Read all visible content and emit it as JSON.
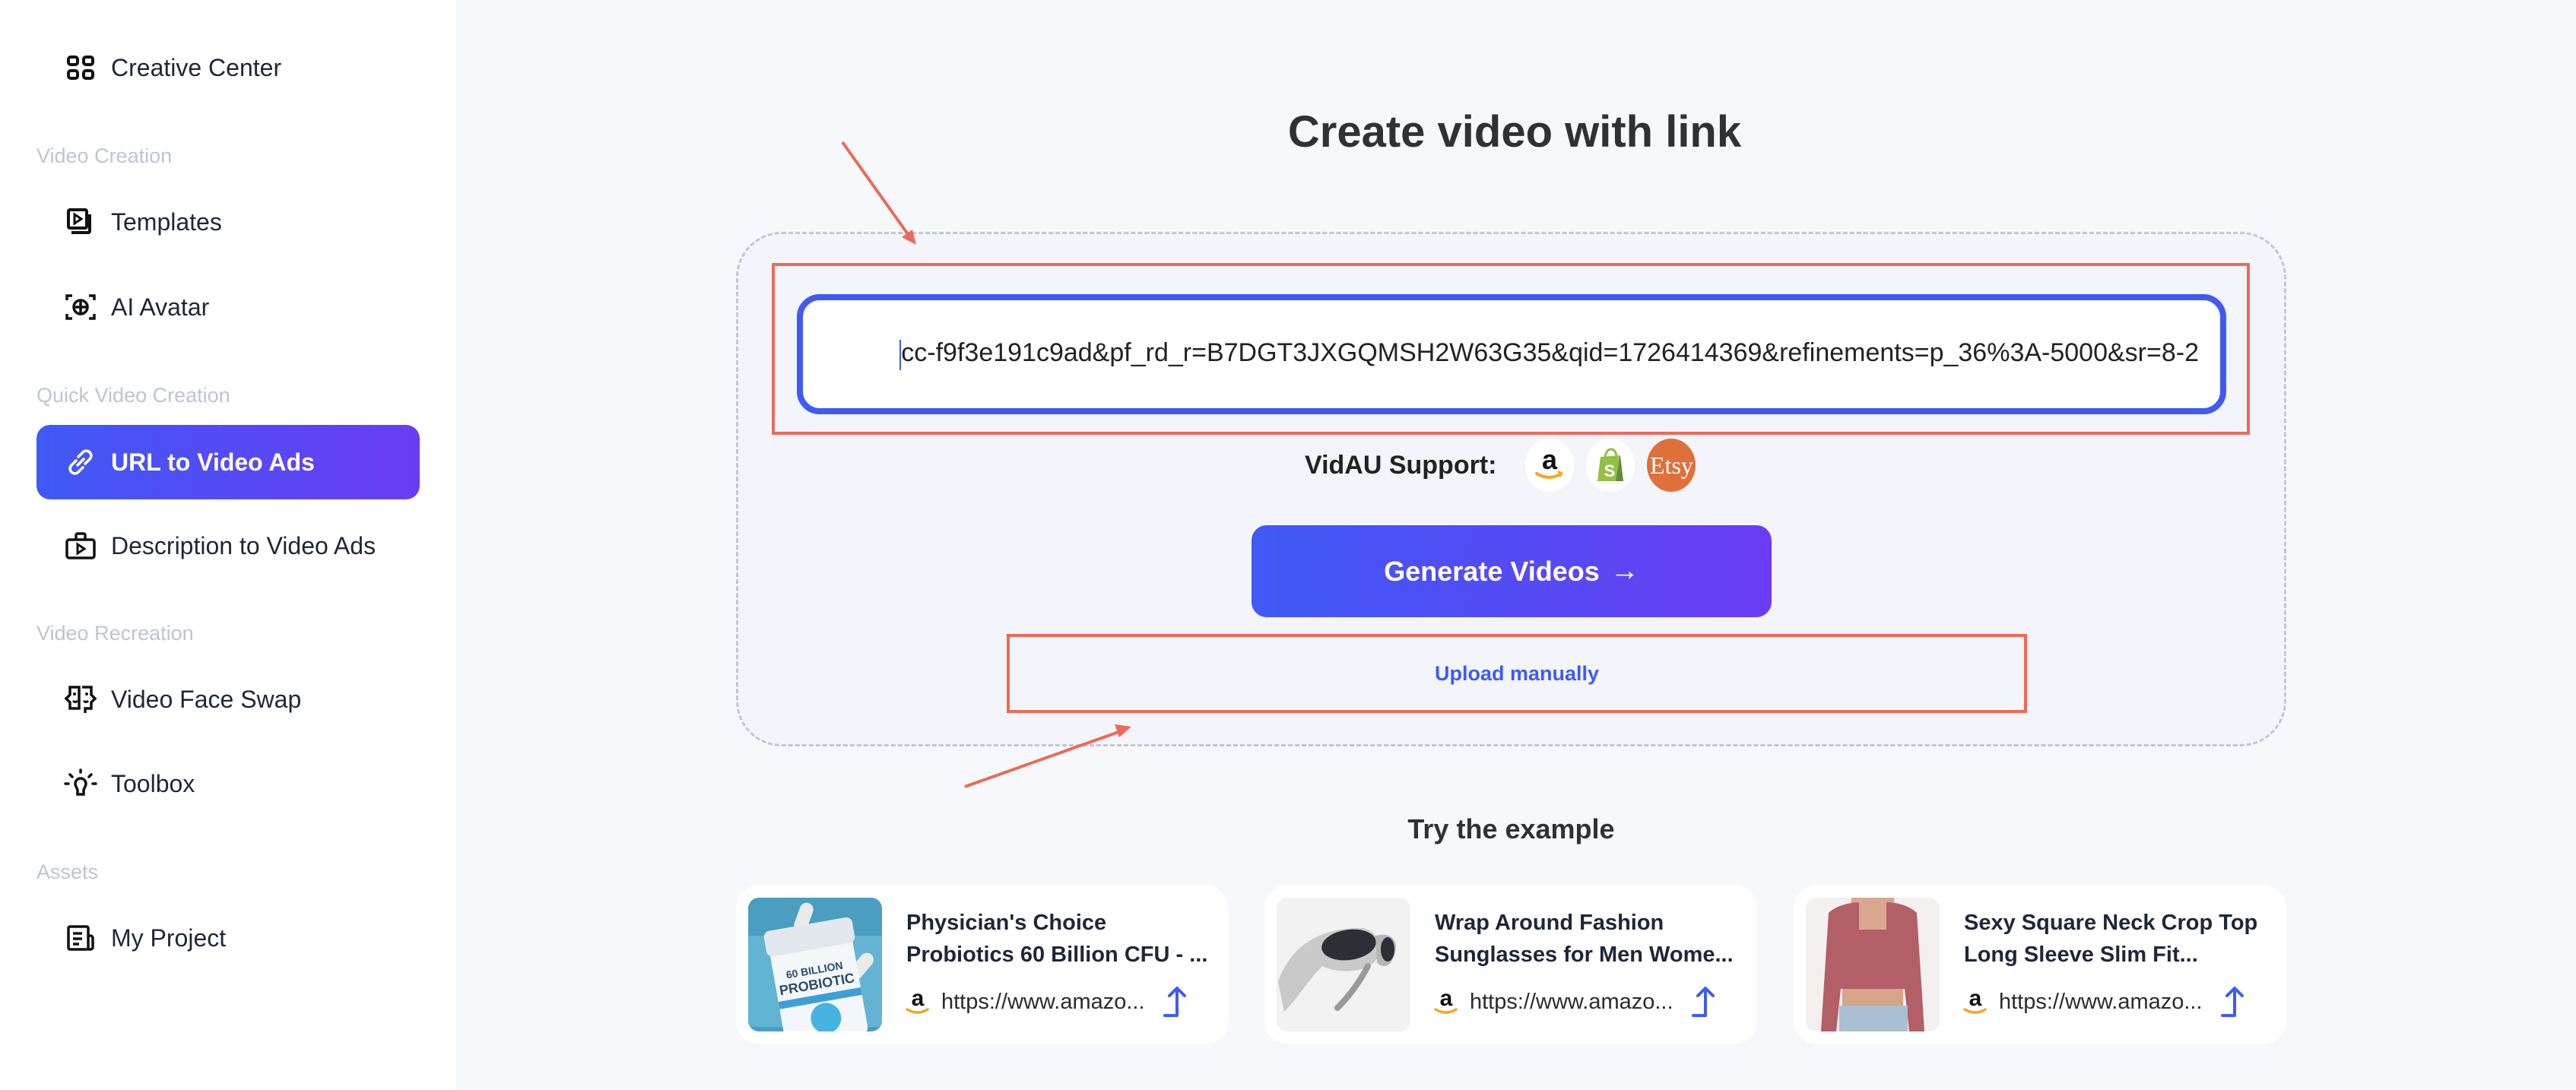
{
  "sidebar": {
    "top_item": {
      "label": "Creative Center",
      "icon": "grid-icon"
    },
    "sections": [
      {
        "label": "Video Creation",
        "items": [
          {
            "label": "Templates",
            "icon": "video-templates-icon"
          },
          {
            "label": "AI Avatar",
            "icon": "ai-avatar-icon"
          }
        ]
      },
      {
        "label": "Quick Video Creation",
        "items": [
          {
            "label": "URL to Video Ads",
            "icon": "link-icon",
            "active": true
          },
          {
            "label": "Description to Video Ads",
            "icon": "video-bag-icon"
          }
        ]
      },
      {
        "label": "Video Recreation",
        "items": [
          {
            "label": "Video Face Swap",
            "icon": "face-swap-icon"
          },
          {
            "label": "Toolbox",
            "icon": "lightbulb-icon"
          }
        ]
      },
      {
        "label": "Assets",
        "items": [
          {
            "label": "My Project",
            "icon": "project-icon"
          }
        ]
      }
    ]
  },
  "main": {
    "title": "Create video with link",
    "url_input": {
      "value": "cc-f9f3e191c9ad&pf_rd_r=B7DGT3JXGQMSH2W63G35&qid=1726414369&refinements=p_36%3A-5000&sr=8-2"
    },
    "support": {
      "label": "VidAU Support:",
      "platforms": [
        "Amazon",
        "Shopify",
        "Etsy"
      ],
      "etsy_text": "Etsy"
    },
    "generate_button": {
      "label": "Generate Videos",
      "arrow": "→"
    },
    "upload_link": "Upload manually",
    "examples_title": "Try the example",
    "examples": [
      {
        "title_line1": "Physician's Choice",
        "title_line2": "Probiotics 60 Billion CFU - ...",
        "url": "https://www.amazo...",
        "source": "amazon",
        "thumb_text": "60 BILLION PROBIOTIC"
      },
      {
        "title_line1": "Wrap Around Fashion",
        "title_line2": "Sunglasses for Men Wome...",
        "url": "https://www.amazo...",
        "source": "amazon"
      },
      {
        "title_line1": "Sexy Square Neck Crop Top",
        "title_line2": "Long Sleeve Slim Fit...",
        "url": "https://www.amazo...",
        "source": "amazon"
      }
    ]
  },
  "colors": {
    "accent_start": "#3f5af5",
    "accent_end": "#6a3cf4",
    "annotation": "#ec6a58",
    "etsy": "#e0703a",
    "shopify": "#95bf47",
    "amazon_smile": "#f5a623"
  }
}
